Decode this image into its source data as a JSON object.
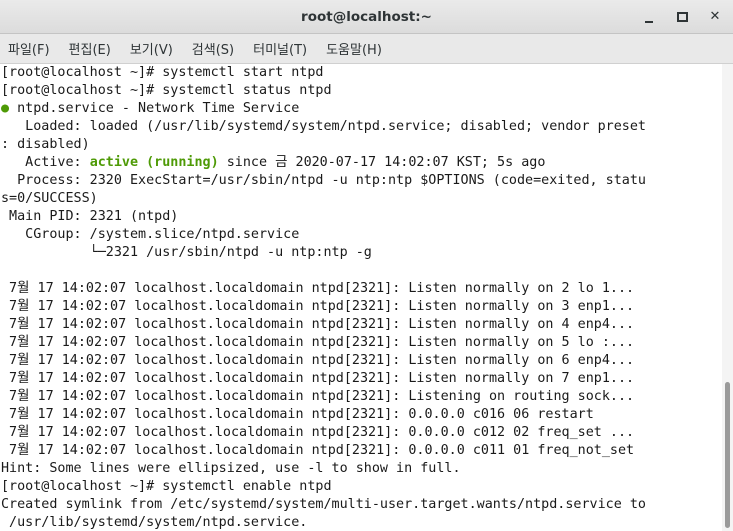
{
  "window": {
    "title": "root@localhost:~",
    "minimize_label": "",
    "maximize_label": "",
    "close_label": "✕"
  },
  "menu": [
    {
      "label": "파일(F)"
    },
    {
      "label": "편집(E)"
    },
    {
      "label": "보기(V)"
    },
    {
      "label": "검색(S)"
    },
    {
      "label": "터미널(T)"
    },
    {
      "label": "도움말(H)"
    }
  ],
  "colors": {
    "active_green": "#4e9a06",
    "titlebar": "#dcdcdc"
  },
  "lines": [
    {
      "text": "[root@localhost ~]# systemctl start ntpd"
    },
    {
      "text": "[root@localhost ~]# systemctl status ntpd"
    },
    {
      "dot": "●",
      "text": " ntpd.service - Network Time Service"
    },
    {
      "text": "   Loaded: loaded (/usr/lib/systemd/system/ntpd.service; disabled; vendor preset"
    },
    {
      "text": ": disabled)"
    },
    {
      "pre": "   Active: ",
      "green": "active (running)",
      "text": " since 금 2020-07-17 14:02:07 KST; 5s ago"
    },
    {
      "text": "  Process: 2320 ExecStart=/usr/sbin/ntpd -u ntp:ntp $OPTIONS (code=exited, statu"
    },
    {
      "text": "s=0/SUCCESS)"
    },
    {
      "text": " Main PID: 2321 (ntpd)"
    },
    {
      "text": "   CGroup: /system.slice/ntpd.service"
    },
    {
      "text": "           └─2321 /usr/sbin/ntpd -u ntp:ntp -g"
    },
    {
      "text": ""
    },
    {
      "text": " 7월 17 14:02:07 localhost.localdomain ntpd[2321]: Listen normally on 2 lo 1..."
    },
    {
      "text": " 7월 17 14:02:07 localhost.localdomain ntpd[2321]: Listen normally on 3 enp1..."
    },
    {
      "text": " 7월 17 14:02:07 localhost.localdomain ntpd[2321]: Listen normally on 4 enp4..."
    },
    {
      "text": " 7월 17 14:02:07 localhost.localdomain ntpd[2321]: Listen normally on 5 lo :..."
    },
    {
      "text": " 7월 17 14:02:07 localhost.localdomain ntpd[2321]: Listen normally on 6 enp4..."
    },
    {
      "text": " 7월 17 14:02:07 localhost.localdomain ntpd[2321]: Listen normally on 7 enp1..."
    },
    {
      "text": " 7월 17 14:02:07 localhost.localdomain ntpd[2321]: Listening on routing sock..."
    },
    {
      "text": " 7월 17 14:02:07 localhost.localdomain ntpd[2321]: 0.0.0.0 c016 06 restart"
    },
    {
      "text": " 7월 17 14:02:07 localhost.localdomain ntpd[2321]: 0.0.0.0 c012 02 freq_set ..."
    },
    {
      "text": " 7월 17 14:02:07 localhost.localdomain ntpd[2321]: 0.0.0.0 c011 01 freq_not_set"
    },
    {
      "text": "Hint: Some lines were ellipsized, use -l to show in full."
    },
    {
      "text": "[root@localhost ~]# systemctl enable ntpd"
    },
    {
      "text": "Created symlink from /etc/systemd/system/multi-user.target.wants/ntpd.service to"
    },
    {
      "text": " /usr/lib/systemd/system/ntpd.service."
    }
  ]
}
